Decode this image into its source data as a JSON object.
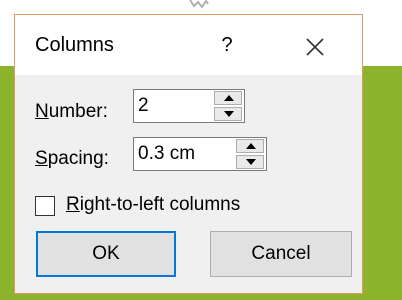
{
  "dialog": {
    "title": "Columns",
    "help_label": "?",
    "close_icon": "close-icon"
  },
  "number": {
    "label_access": "N",
    "label_rest": "umber:",
    "value": "2"
  },
  "spacing": {
    "label_access": "S",
    "label_rest": "pacing:",
    "value": "0.3 cm"
  },
  "rtl": {
    "label_access": "R",
    "label_rest": "ight-to-left columns",
    "checked": false
  },
  "buttons": {
    "ok_label": "OK",
    "cancel_label": "Cancel"
  },
  "colors": {
    "background_green": "#8db22b",
    "dialog_border": "#dd9a66",
    "default_button_border": "#0078d7"
  }
}
